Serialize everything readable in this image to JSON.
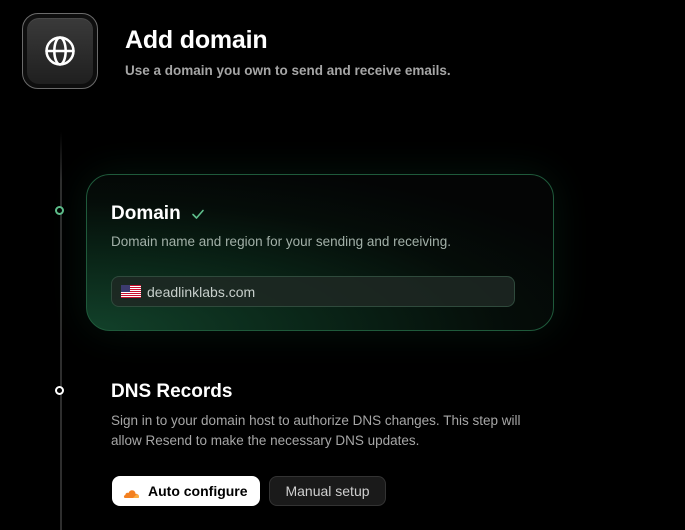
{
  "header": {
    "title": "Add domain",
    "subtitle": "Use a domain you own to send and receive emails.",
    "logo_icon": "globe-icon"
  },
  "steps": {
    "domain": {
      "title": "Domain",
      "status_icon": "check-icon",
      "status": "complete",
      "description": "Domain name and region for your sending and receiving.",
      "field": {
        "region_icon": "us-flag-icon",
        "value": "deadlinklabs.com"
      }
    },
    "dns": {
      "title": "DNS Records",
      "description": "Sign in to your domain host to authorize DNS changes. This step will allow Resend to make the necessary DNS updates.",
      "buttons": {
        "auto_label": "Auto configure",
        "auto_icon": "cloudflare-icon",
        "manual_label": "Manual setup"
      }
    }
  },
  "colors": {
    "background": "#000000",
    "accent_green": "#5fbf8c",
    "card_border": "#1f5a3b",
    "muted_text": "#a6a6a6",
    "cloudflare_orange": "#f38020"
  }
}
